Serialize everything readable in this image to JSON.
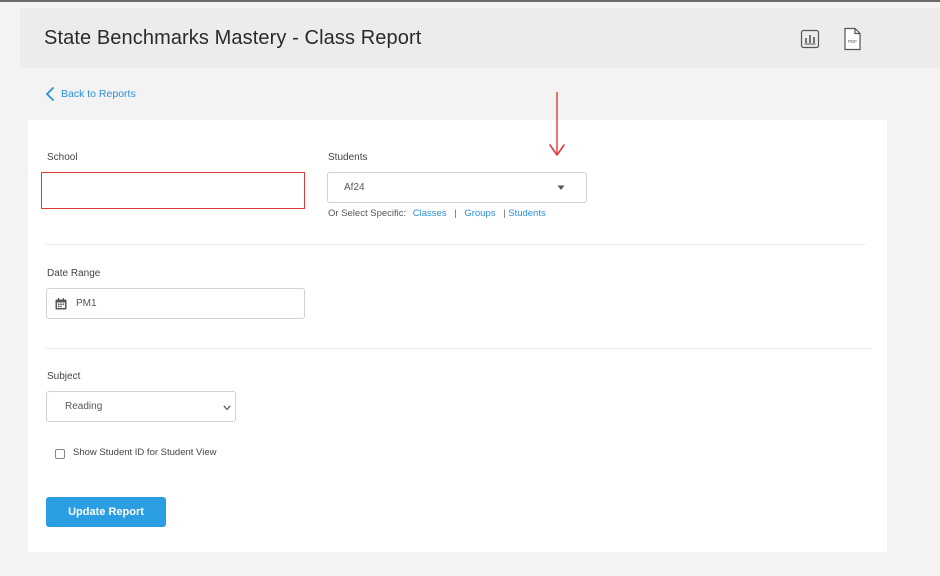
{
  "header": {
    "title": "State Benchmarks Mastery - Class Report",
    "icons": [
      "bar-chart-icon",
      "pdf-icon"
    ],
    "pdf_icon_text": "PDF"
  },
  "back_link": {
    "label": "Back to Reports"
  },
  "form": {
    "school": {
      "label": "School",
      "value": ""
    },
    "students": {
      "label": "Students",
      "value": "Af24",
      "or_select_label": "Or Select Specific:",
      "links": [
        "Classes",
        "Groups",
        "Students"
      ]
    },
    "date_range": {
      "label": "Date Range",
      "value": "PM1"
    },
    "subject": {
      "label": "Subject",
      "value": "Reading"
    },
    "show_student_id": {
      "label": "Show Student ID for Student View",
      "checked": false
    },
    "update_button": {
      "label": "Update Report"
    }
  },
  "colors": {
    "link": "#2b8fd8",
    "button": "#2b9de3",
    "highlight": "#e23a3a"
  },
  "annotation": {
    "icon": "red-down-arrow-icon"
  }
}
